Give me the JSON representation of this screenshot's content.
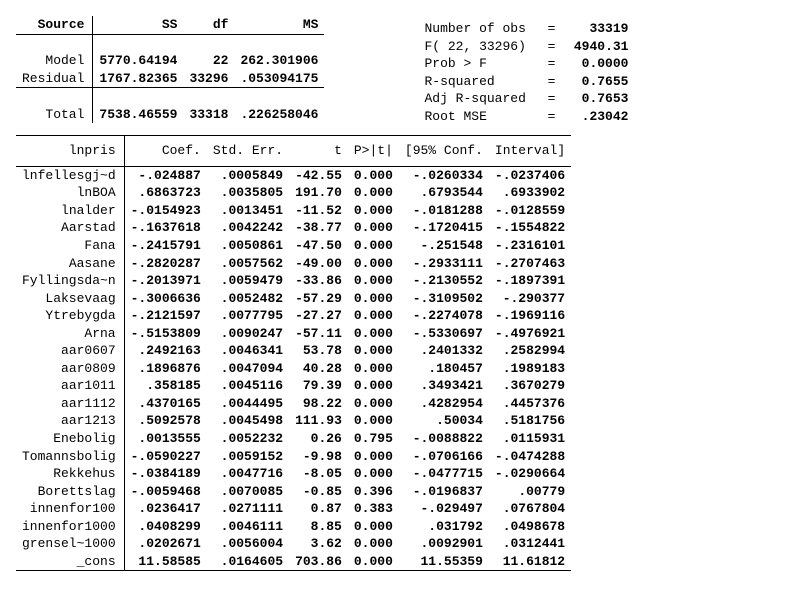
{
  "anova": {
    "headers": {
      "source": "Source",
      "ss": "SS",
      "df": "df",
      "ms": "MS"
    },
    "rows": [
      {
        "label": "Model",
        "ss": "5770.64194",
        "df": "22",
        "ms": "262.301906"
      },
      {
        "label": "Residual",
        "ss": "1767.82365",
        "df": "33296",
        "ms": ".053094175"
      }
    ],
    "total": {
      "label": "Total",
      "ss": "7538.46559",
      "df": "33318",
      "ms": ".226258046"
    }
  },
  "stats": [
    {
      "label": "Number of obs",
      "value": "33319"
    },
    {
      "label": "F( 22, 33296)",
      "value": "4940.31"
    },
    {
      "label": "Prob > F",
      "value": "0.0000"
    },
    {
      "label": "R-squared",
      "value": "0.7655"
    },
    {
      "label": "Adj R-squared",
      "value": "0.7653"
    },
    {
      "label": "Root MSE",
      "value": ".23042"
    }
  ],
  "coef": {
    "depvar": "lnpris",
    "headers": {
      "coef": "Coef.",
      "se": "Std. Err.",
      "t": "t",
      "p": "P>|t|",
      "ci": "[95% Conf.",
      "ci2": "Interval]"
    },
    "rows": [
      {
        "var": "lnfellesgj~d",
        "coef": "-.024887",
        "se": ".0005849",
        "t": "-42.55",
        "p": "0.000",
        "lo": "-.0260334",
        "hi": "-.0237406"
      },
      {
        "var": "lnBOA",
        "coef": ".6863723",
        "se": ".0035805",
        "t": "191.70",
        "p": "0.000",
        "lo": ".6793544",
        "hi": ".6933902"
      },
      {
        "var": "lnalder",
        "coef": "-.0154923",
        "se": ".0013451",
        "t": "-11.52",
        "p": "0.000",
        "lo": "-.0181288",
        "hi": "-.0128559"
      },
      {
        "var": "Aarstad",
        "coef": "-.1637618",
        "se": ".0042242",
        "t": "-38.77",
        "p": "0.000",
        "lo": "-.1720415",
        "hi": "-.1554822"
      },
      {
        "var": "Fana",
        "coef": "-.2415791",
        "se": ".0050861",
        "t": "-47.50",
        "p": "0.000",
        "lo": "-.251548",
        "hi": "-.2316101"
      },
      {
        "var": "Aasane",
        "coef": "-.2820287",
        "se": ".0057562",
        "t": "-49.00",
        "p": "0.000",
        "lo": "-.2933111",
        "hi": "-.2707463"
      },
      {
        "var": "Fyllingsda~n",
        "coef": "-.2013971",
        "se": ".0059479",
        "t": "-33.86",
        "p": "0.000",
        "lo": "-.2130552",
        "hi": "-.1897391"
      },
      {
        "var": "Laksevaag",
        "coef": "-.3006636",
        "se": ".0052482",
        "t": "-57.29",
        "p": "0.000",
        "lo": "-.3109502",
        "hi": "-.290377"
      },
      {
        "var": "Ytrebygda",
        "coef": "-.2121597",
        "se": ".0077795",
        "t": "-27.27",
        "p": "0.000",
        "lo": "-.2274078",
        "hi": "-.1969116"
      },
      {
        "var": "Arna",
        "coef": "-.5153809",
        "se": ".0090247",
        "t": "-57.11",
        "p": "0.000",
        "lo": "-.5330697",
        "hi": "-.4976921"
      },
      {
        "var": "aar0607",
        "coef": ".2492163",
        "se": ".0046341",
        "t": "53.78",
        "p": "0.000",
        "lo": ".2401332",
        "hi": ".2582994"
      },
      {
        "var": "aar0809",
        "coef": ".1896876",
        "se": ".0047094",
        "t": "40.28",
        "p": "0.000",
        "lo": ".180457",
        "hi": ".1989183"
      },
      {
        "var": "aar1011",
        "coef": ".358185",
        "se": ".0045116",
        "t": "79.39",
        "p": "0.000",
        "lo": ".3493421",
        "hi": ".3670279"
      },
      {
        "var": "aar1112",
        "coef": ".4370165",
        "se": ".0044495",
        "t": "98.22",
        "p": "0.000",
        "lo": ".4282954",
        "hi": ".4457376"
      },
      {
        "var": "aar1213",
        "coef": ".5092578",
        "se": ".0045498",
        "t": "111.93",
        "p": "0.000",
        "lo": ".50034",
        "hi": ".5181756"
      },
      {
        "var": "Enebolig",
        "coef": ".0013555",
        "se": ".0052232",
        "t": "0.26",
        "p": "0.795",
        "lo": "-.0088822",
        "hi": ".0115931"
      },
      {
        "var": "Tomannsbolig",
        "coef": "-.0590227",
        "se": ".0059152",
        "t": "-9.98",
        "p": "0.000",
        "lo": "-.0706166",
        "hi": "-.0474288"
      },
      {
        "var": "Rekkehus",
        "coef": "-.0384189",
        "se": ".0047716",
        "t": "-8.05",
        "p": "0.000",
        "lo": "-.0477715",
        "hi": "-.0290664"
      },
      {
        "var": "Borettslag",
        "coef": "-.0059468",
        "se": ".0070085",
        "t": "-0.85",
        "p": "0.396",
        "lo": "-.0196837",
        "hi": ".00779"
      },
      {
        "var": "innenfor100",
        "coef": ".0236417",
        "se": ".0271111",
        "t": "0.87",
        "p": "0.383",
        "lo": "-.029497",
        "hi": ".0767804"
      },
      {
        "var": "innenfor1000",
        "coef": ".0408299",
        "se": ".0046111",
        "t": "8.85",
        "p": "0.000",
        "lo": ".031792",
        "hi": ".0498678"
      },
      {
        "var": "grensel~1000",
        "coef": ".0202671",
        "se": ".0056004",
        "t": "3.62",
        "p": "0.000",
        "lo": ".0092901",
        "hi": ".0312441"
      },
      {
        "var": "_cons",
        "coef": "11.58585",
        "se": ".0164605",
        "t": "703.86",
        "p": "0.000",
        "lo": "11.55359",
        "hi": "11.61812"
      }
    ]
  }
}
